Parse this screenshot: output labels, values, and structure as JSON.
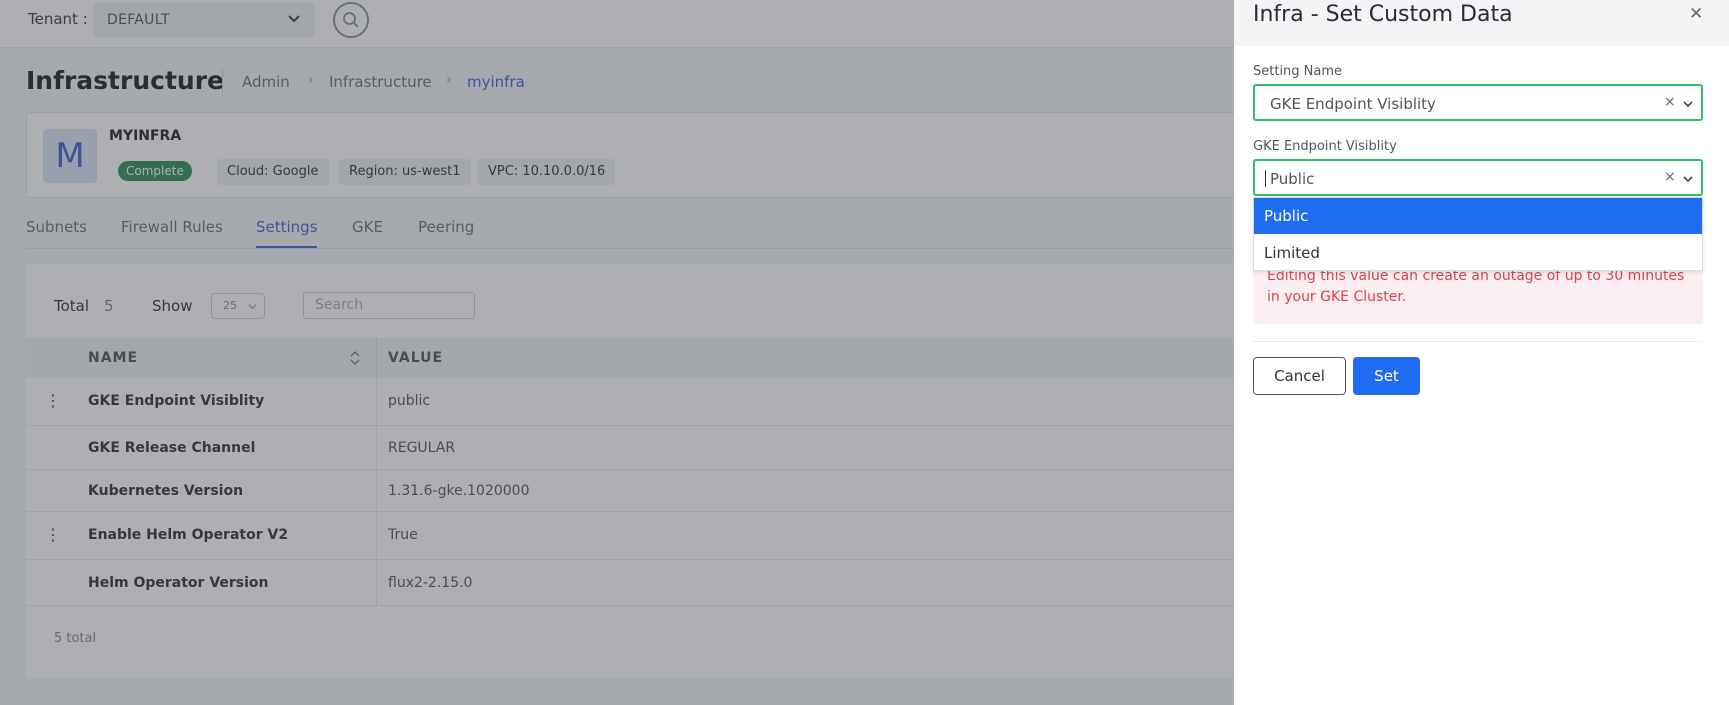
{
  "topbar": {
    "tenant_label": "Tenant :",
    "tenant_value": "DEFAULT"
  },
  "header": {
    "title": "Infrastructure",
    "breadcrumb": [
      "Admin",
      "Infrastructure",
      "myinfra"
    ]
  },
  "infra": {
    "avatar_letter": "M",
    "name": "MYINFRA",
    "status": "Complete",
    "cloud": "Cloud: Google",
    "region": "Region: us-west1",
    "vpc": "VPC: 10.10.0.0/16"
  },
  "tabs": [
    "Subnets",
    "Firewall Rules",
    "Settings",
    "GKE",
    "Peering"
  ],
  "table": {
    "total_label": "Total",
    "total_count": "5",
    "show_label": "Show",
    "page_size": "25",
    "search_placeholder": "Search",
    "columns": [
      "NAME",
      "VALUE"
    ],
    "rows": [
      {
        "name": "GKE Endpoint Visiblity",
        "value": "public"
      },
      {
        "name": "GKE Release Channel",
        "value": "REGULAR"
      },
      {
        "name": "Kubernetes Version",
        "value": "1.31.6-gke.1020000"
      },
      {
        "name": "Enable Helm Operator V2",
        "value": "True"
      },
      {
        "name": "Helm Operator Version",
        "value": "flux2-2.15.0"
      }
    ],
    "footer": "5 total"
  },
  "panel": {
    "title": "Infra - Set Custom Data",
    "setting_name_label": "Setting Name",
    "setting_name_value": "GKE Endpoint Visiblity",
    "value_label": "GKE Endpoint Visiblity",
    "value_current": "Public",
    "options": [
      "Public",
      "Limited"
    ],
    "selected_option": "Public",
    "warning": "Editing this value can create an outage of up to 30 minutes in your GKE Cluster.",
    "cancel_label": "Cancel",
    "set_label": "Set"
  },
  "colors": {
    "accent": "#1f6cf0",
    "focus_border": "#2fbf6a",
    "warning_text": "#d9434f",
    "status_complete": "#2f8f5a"
  },
  "icons": {
    "close": "close-icon",
    "clear": "clear-icon",
    "chevron": "chevron-down-icon",
    "search": "search-icon",
    "kebab": "kebab-menu-icon",
    "sort": "sort-icon"
  }
}
